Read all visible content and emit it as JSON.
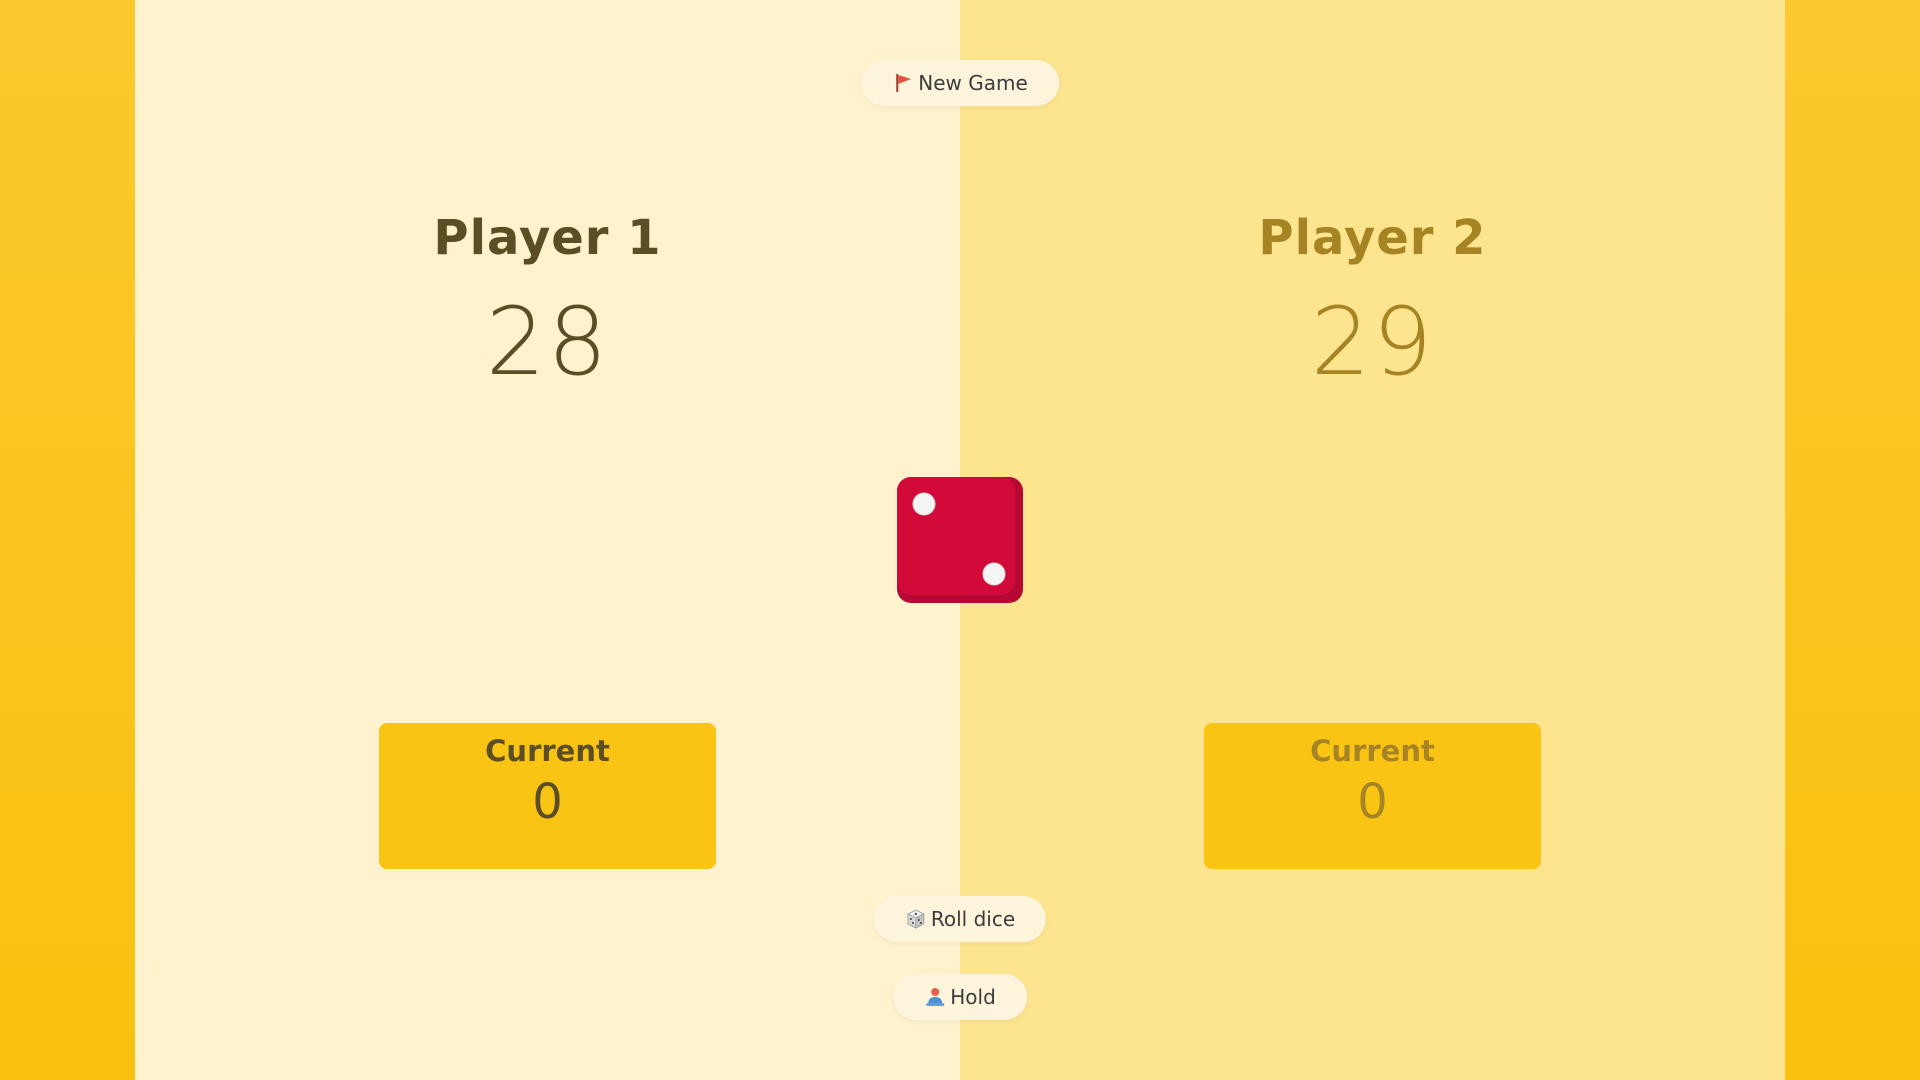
{
  "buttons": {
    "new_game": "New Game",
    "roll_dice": "Roll dice",
    "hold": "Hold"
  },
  "players": [
    {
      "name": "Player 1",
      "score": "28",
      "current_label": "Current",
      "current_score": "0",
      "active": true
    },
    {
      "name": "Player 2",
      "score": "29",
      "current_label": "Current",
      "current_score": "0",
      "active": false
    }
  ],
  "dice": {
    "value": 2,
    "color": "#d20a3a"
  },
  "icons": {
    "new_game": "flag-icon",
    "roll_dice": "dice-icon",
    "hold": "person-icon"
  },
  "colors": {
    "background": "#fcc82f",
    "active_panel": "#fff2cd",
    "inactive_panel": "#fde48e",
    "current_box": "#f9c414"
  }
}
